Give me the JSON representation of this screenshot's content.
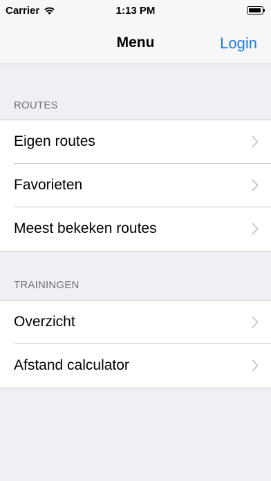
{
  "status_bar": {
    "carrier": "Carrier",
    "time": "1:13 PM",
    "battery_level": 0.95
  },
  "nav": {
    "title": "Menu",
    "login": "Login"
  },
  "sections": [
    {
      "header": "ROUTES",
      "items": [
        {
          "label": "Eigen routes"
        },
        {
          "label": "Favorieten"
        },
        {
          "label": "Meest bekeken routes"
        }
      ]
    },
    {
      "header": "TRAININGEN",
      "items": [
        {
          "label": "Overzicht"
        },
        {
          "label": "Afstand calculator"
        }
      ]
    }
  ],
  "colors": {
    "accent": "#1a7cf2",
    "background": "#efeff4",
    "separator": "#c8c7cc",
    "section_header": "#6d6d72",
    "chevron": "#c7c7cc"
  },
  "icons": {
    "row_accessory": "chevron-right-icon",
    "wifi": "wifi-icon",
    "battery": "battery-icon"
  }
}
